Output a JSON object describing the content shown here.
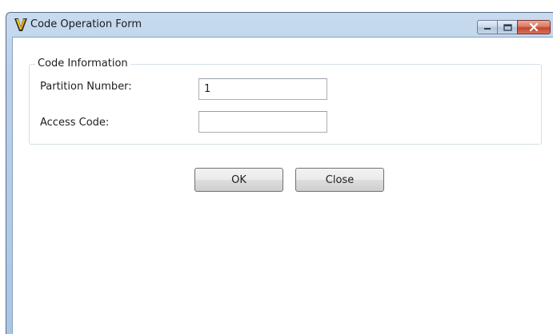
{
  "window": {
    "title": "Code Operation Form",
    "icon": "v-logo-icon"
  },
  "caption_buttons": {
    "minimize": "minimize-icon",
    "maximize": "maximize-icon",
    "close": "close-icon"
  },
  "group": {
    "legend": "Code Information",
    "partition_label": "Partition Number:",
    "partition_value": "1",
    "access_label": "Access Code:",
    "access_value": ""
  },
  "buttons": {
    "ok_label": "OK",
    "close_label": "Close"
  },
  "colors": {
    "title_bar": "#bad0ea",
    "close_button": "#c6452c",
    "icon_yellow": "#f2c21a",
    "icon_dark": "#2b2b2b"
  }
}
